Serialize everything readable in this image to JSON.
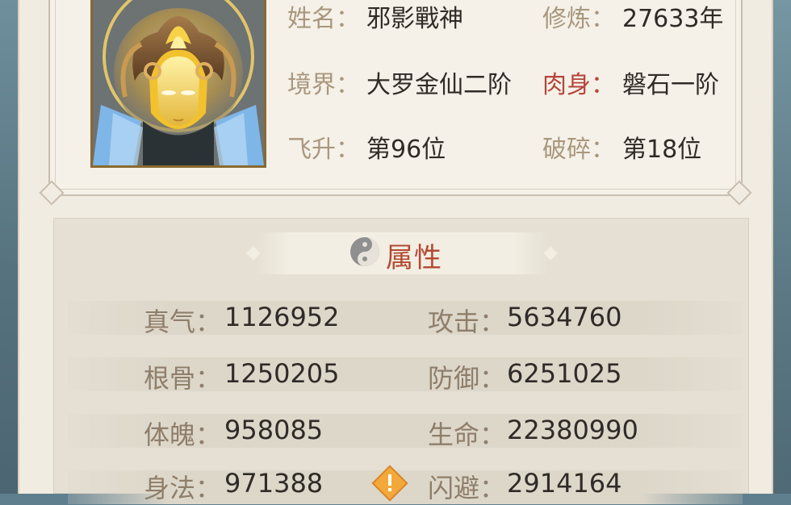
{
  "character": {
    "name_label": "姓名",
    "name": "邪影戰神",
    "cultivation_label": "修炼",
    "cultivation": "27633年",
    "realm_label": "境界",
    "realm": "大罗金仙二阶",
    "body_label": "肉身",
    "body": "磐石一阶",
    "ascension_label": "飞升",
    "ascension": "第96位",
    "shatter_label": "破碎",
    "shatter": "第18位"
  },
  "attributes": {
    "title": "属性",
    "stats": [
      {
        "label": "真气",
        "value": "1126952"
      },
      {
        "label": "攻击",
        "value": "5634760"
      },
      {
        "label": "根骨",
        "value": "1250205"
      },
      {
        "label": "防御",
        "value": "6251025"
      },
      {
        "label": "体魄",
        "value": "958085"
      },
      {
        "label": "生命",
        "value": "22380990"
      },
      {
        "label": "身法",
        "value": "971388"
      },
      {
        "label": "闪避",
        "value": "2914164"
      }
    ]
  },
  "colors": {
    "label": "#a9977e",
    "value": "#2f2b27",
    "title": "#b24a33",
    "portrait_border": "#8a6a30"
  },
  "icons": {
    "portrait": "helmet-warrior-portrait",
    "attr_title": "yin-yang-icon",
    "warning": "warning-diamond-icon"
  }
}
